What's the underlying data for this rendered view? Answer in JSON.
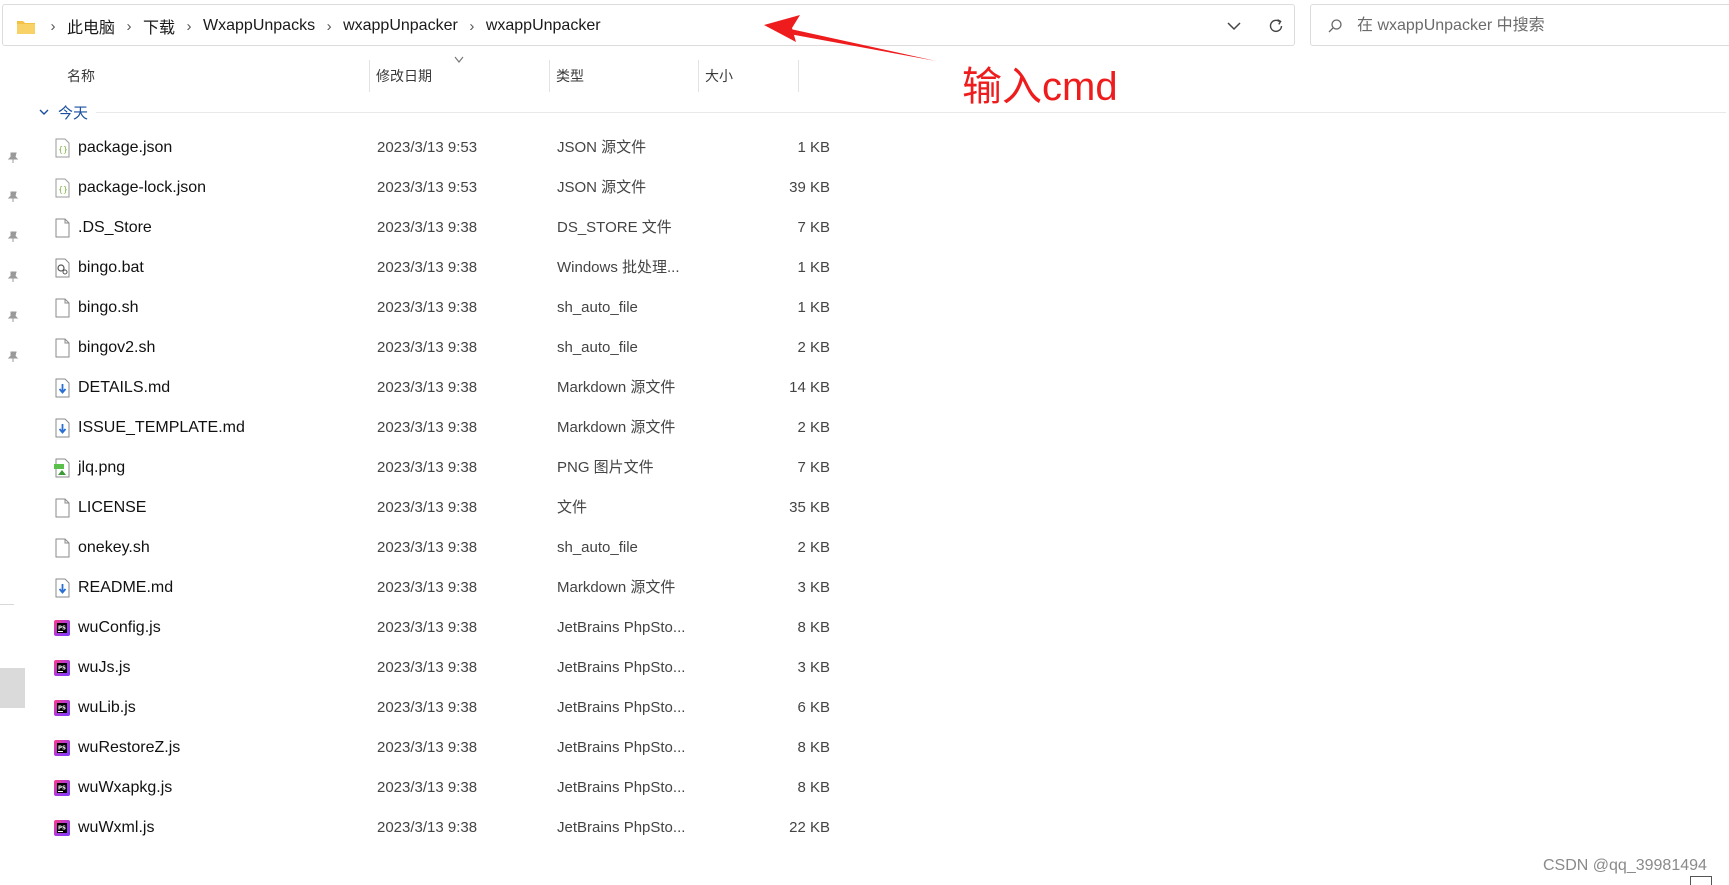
{
  "breadcrumb": [
    "此电脑",
    "下载",
    "WxappUnpacks",
    "wxappUnpacker",
    "wxappUnpacker"
  ],
  "search": {
    "placeholder": "在 wxappUnpacker 中搜索"
  },
  "columns": {
    "name": "名称",
    "modified": "修改日期",
    "type": "类型",
    "size": "大小"
  },
  "group": {
    "label": "今天"
  },
  "files": [
    {
      "name": "package.json",
      "modified": "2023/3/13 9:53",
      "type": "JSON 源文件",
      "size": "1 KB",
      "icon": "json-file-icon"
    },
    {
      "name": "package-lock.json",
      "modified": "2023/3/13 9:53",
      "type": "JSON 源文件",
      "size": "39 KB",
      "icon": "json-file-icon"
    },
    {
      "name": ".DS_Store",
      "modified": "2023/3/13 9:38",
      "type": "DS_STORE 文件",
      "size": "7 KB",
      "icon": "blank-file-icon"
    },
    {
      "name": "bingo.bat",
      "modified": "2023/3/13 9:38",
      "type": "Windows 批处理...",
      "size": "1 KB",
      "icon": "batch-file-icon"
    },
    {
      "name": "bingo.sh",
      "modified": "2023/3/13 9:38",
      "type": "sh_auto_file",
      "size": "1 KB",
      "icon": "blank-file-icon"
    },
    {
      "name": "bingov2.sh",
      "modified": "2023/3/13 9:38",
      "type": "sh_auto_file",
      "size": "2 KB",
      "icon": "blank-file-icon"
    },
    {
      "name": "DETAILS.md",
      "modified": "2023/3/13 9:38",
      "type": "Markdown 源文件",
      "size": "14 KB",
      "icon": "markdown-file-icon"
    },
    {
      "name": "ISSUE_TEMPLATE.md",
      "modified": "2023/3/13 9:38",
      "type": "Markdown 源文件",
      "size": "2 KB",
      "icon": "markdown-file-icon"
    },
    {
      "name": "jlq.png",
      "modified": "2023/3/13 9:38",
      "type": "PNG 图片文件",
      "size": "7 KB",
      "icon": "image-file-icon"
    },
    {
      "name": "LICENSE",
      "modified": "2023/3/13 9:38",
      "type": "文件",
      "size": "35 KB",
      "icon": "blank-file-icon"
    },
    {
      "name": "onekey.sh",
      "modified": "2023/3/13 9:38",
      "type": "sh_auto_file",
      "size": "2 KB",
      "icon": "blank-file-icon"
    },
    {
      "name": "README.md",
      "modified": "2023/3/13 9:38",
      "type": "Markdown 源文件",
      "size": "3 KB",
      "icon": "markdown-file-icon"
    },
    {
      "name": "wuConfig.js",
      "modified": "2023/3/13 9:38",
      "type": "JetBrains PhpSto...",
      "size": "8 KB",
      "icon": "phpstorm-file-icon"
    },
    {
      "name": "wuJs.js",
      "modified": "2023/3/13 9:38",
      "type": "JetBrains PhpSto...",
      "size": "3 KB",
      "icon": "phpstorm-file-icon"
    },
    {
      "name": "wuLib.js",
      "modified": "2023/3/13 9:38",
      "type": "JetBrains PhpSto...",
      "size": "6 KB",
      "icon": "phpstorm-file-icon"
    },
    {
      "name": "wuRestoreZ.js",
      "modified": "2023/3/13 9:38",
      "type": "JetBrains PhpSto...",
      "size": "8 KB",
      "icon": "phpstorm-file-icon"
    },
    {
      "name": "wuWxapkg.js",
      "modified": "2023/3/13 9:38",
      "type": "JetBrains PhpSto...",
      "size": "8 KB",
      "icon": "phpstorm-file-icon"
    },
    {
      "name": "wuWxml.js",
      "modified": "2023/3/13 9:38",
      "type": "JetBrains PhpSto...",
      "size": "22 KB",
      "icon": "phpstorm-file-icon"
    }
  ],
  "annotation": {
    "text": "输入cmd",
    "color": "#ee1c1c"
  },
  "watermark": "CSDN @qq_39981494",
  "colors": {
    "folder": "#f3c244",
    "accent": "#1a4fa0",
    "phpstorm": "#b03bd6"
  }
}
